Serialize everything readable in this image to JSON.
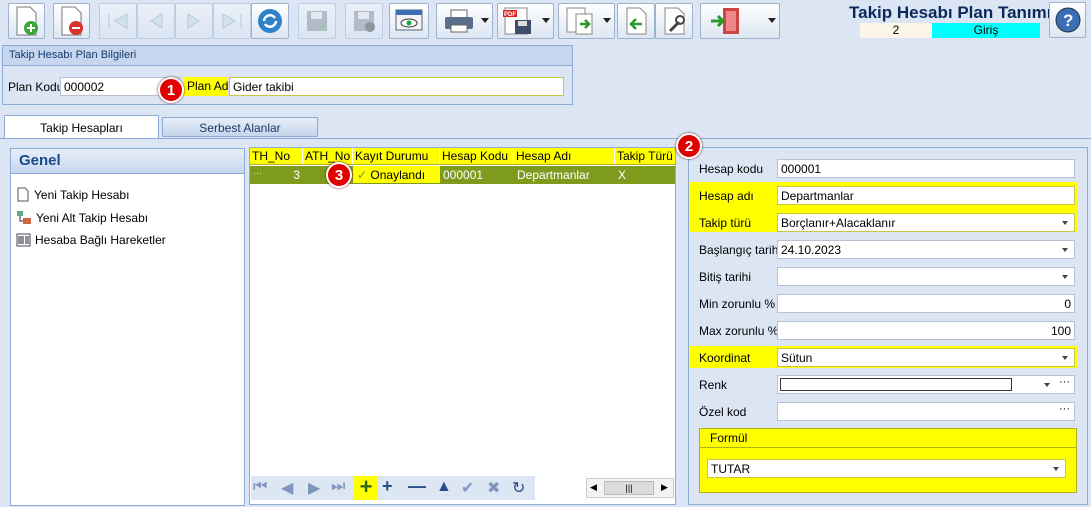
{
  "header": {
    "title": "Takip Hesabı Plan Tanımı",
    "record_no": "2",
    "mode": "Giriş"
  },
  "toolbar": {
    "icons": [
      "new-doc-icon",
      "delete-doc-icon",
      "first-record-icon",
      "prev-record-icon",
      "next-record-icon",
      "last-record-icon",
      "refresh-icon",
      "save-icon",
      "save-cancel-icon",
      "preview-icon",
      "print-icon",
      "pdf-save-icon",
      "export-icon",
      "back-icon",
      "tools-icon",
      "exit-door-icon",
      "help-icon"
    ]
  },
  "plan_info": {
    "group_title": "Takip Hesabı Plan Bilgileri",
    "plan_kodu_label": "Plan Kodu",
    "plan_kodu": "000002",
    "plan_adi_label": "Plan Adı",
    "plan_adi": "Gider takibi"
  },
  "tabs": [
    {
      "label": "Takip Hesapları"
    },
    {
      "label": "Serbest Alanlar"
    }
  ],
  "left_panel": {
    "title": "Genel",
    "items": [
      {
        "label": "Yeni Takip Hesabı",
        "icon": "doc-icon"
      },
      {
        "label": "Yeni Alt Takip Hesabı",
        "icon": "sub-account-icon"
      },
      {
        "label": "Hesaba Bağlı Hareketler",
        "icon": "barcode-icon"
      }
    ]
  },
  "grid": {
    "columns": [
      "TH_No",
      "ATH_No",
      "Kayıt Durumu",
      "Hesap Kodu",
      "Hesap Adı",
      "Takip Türü"
    ],
    "rows": [
      {
        "row_indicator": "···",
        "th_no": "3",
        "ath_no": "",
        "kayit_durumu": "Onaylandı",
        "hesap_kodu": "000001",
        "hesap_adi": "Departmanlar",
        "takip_turu": "X"
      }
    ]
  },
  "badges": [
    "1",
    "2",
    "3"
  ],
  "form": {
    "hesap_kodu_label": "Hesap kodu",
    "hesap_kodu": "000001",
    "hesap_adi_label": "Hesap adı",
    "hesap_adi": "Departmanlar",
    "takip_turu_label": "Takip türü",
    "takip_turu": "Borçlanır+Alacaklanır",
    "baslangic_label": "Başlangıç tarihi",
    "baslangic": "24.10.2023",
    "bitis_label": "Bitiş tarihi",
    "bitis": "",
    "min_label": "Min zorunlu %",
    "min": "0",
    "max_label": "Max zorunlu %",
    "max": "100",
    "koordinat_label": "Koordinat",
    "koordinat": "Sütun",
    "renk_label": "Renk",
    "renk": "",
    "ozel_kod_label": "Özel kod",
    "ozel_kod": "",
    "formul_title": "Formül",
    "formul": "TUTAR",
    "ellipsis": "···"
  },
  "colors": {
    "highlight": "#ffff00",
    "grid_row": "#7f9b1e",
    "accent_cyan": "#00ffff",
    "badge": "#e00000"
  }
}
